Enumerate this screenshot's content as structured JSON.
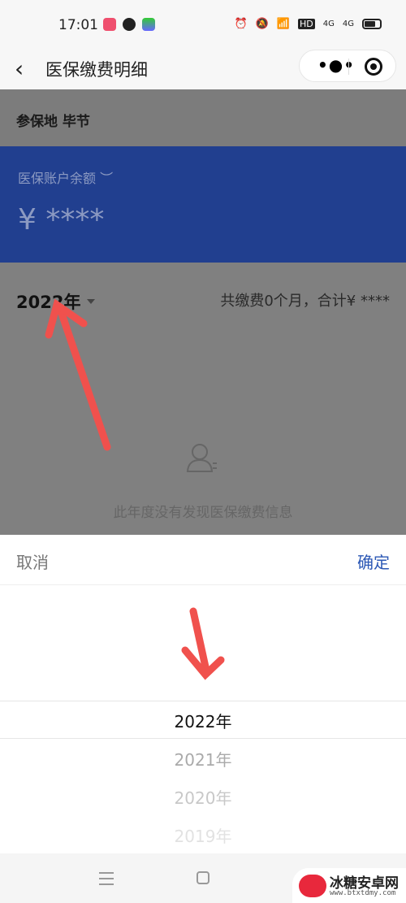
{
  "status_bar": {
    "time": "17:01",
    "icons": [
      "video-app-icon",
      "wechat-icon",
      "app-icon",
      "alarm-icon",
      "mute-icon",
      "wifi-icon",
      "hd-icon",
      "4g-signal-icon",
      "4g-signal-icon",
      "battery-icon"
    ],
    "hd": "HD",
    "net1": "4G",
    "net2": "4G"
  },
  "nav": {
    "title": "医保缴费明细"
  },
  "location": {
    "label": "参保地  毕节"
  },
  "balance": {
    "label": "医保账户余额",
    "amount": "¥ ****"
  },
  "filter": {
    "year": "2022年",
    "summary": "共缴费0个月，合计¥ ****"
  },
  "empty": {
    "message": "此年度没有发现医保缴费信息"
  },
  "picker": {
    "cancel": "取消",
    "confirm": "确定",
    "options": [
      "2022年",
      "2021年",
      "2020年",
      "2019年"
    ],
    "selected": "2022年"
  },
  "annotation_color": "#f0514d",
  "watermark": {
    "name": "冰糖安卓网",
    "url": "www.btxtdmy.com"
  }
}
